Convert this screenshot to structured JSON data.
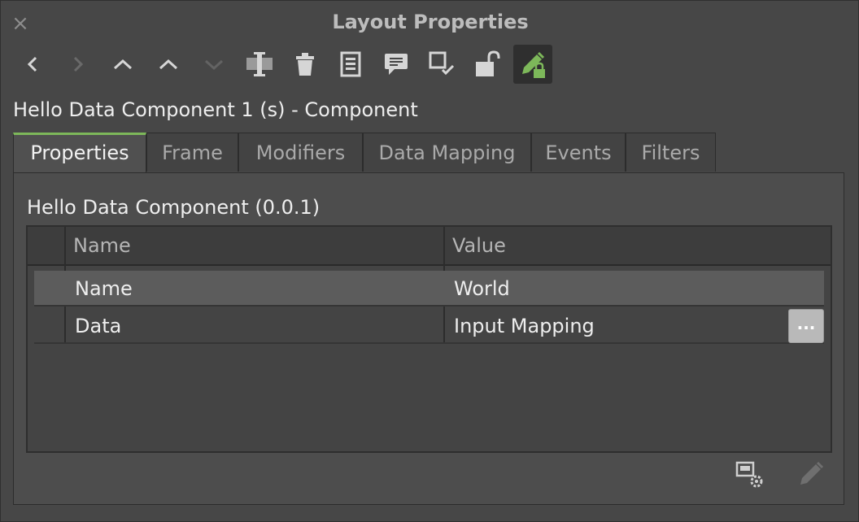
{
  "window": {
    "title": "Layout Properties",
    "close_glyph": "×"
  },
  "toolbar": {
    "buttons": [
      {
        "icon": "chevron-left-icon",
        "enabled": true
      },
      {
        "icon": "chevron-right-icon",
        "enabled": false
      },
      {
        "icon": "chevron-up-icon",
        "enabled": true
      },
      {
        "icon": "chevron-up-alt-icon",
        "enabled": true
      },
      {
        "icon": "chevron-down-icon",
        "enabled": false
      },
      {
        "icon": "align-center-icon",
        "enabled": true
      },
      {
        "icon": "trash-icon",
        "enabled": true
      },
      {
        "icon": "document-icon",
        "enabled": true
      },
      {
        "icon": "comment-icon",
        "enabled": true
      },
      {
        "icon": "checkbox-check-icon",
        "enabled": true
      },
      {
        "icon": "unlock-icon",
        "enabled": true
      },
      {
        "icon": "edit-lock-icon",
        "enabled": true,
        "active": true
      }
    ]
  },
  "component_title": "Hello Data Component 1 (s) - Component",
  "tabs": [
    {
      "label": "Properties",
      "active": true
    },
    {
      "label": "Frame"
    },
    {
      "label": "Modifiers"
    },
    {
      "label": "Data Mapping"
    },
    {
      "label": "Events"
    },
    {
      "label": "Filters"
    }
  ],
  "section_title": "Hello Data Component (0.0.1)",
  "table": {
    "columns": [
      "Name",
      "Value"
    ],
    "rows": [
      {
        "name": "Name",
        "value": "World",
        "selected": true
      },
      {
        "name": "Data",
        "value": "Input Mapping",
        "has_button": true,
        "button_label": "..."
      }
    ]
  },
  "bottom_icons": [
    "settings-window-icon",
    "pencil-icon"
  ],
  "colors": {
    "accent": "#7db85a",
    "background": "#474747"
  }
}
